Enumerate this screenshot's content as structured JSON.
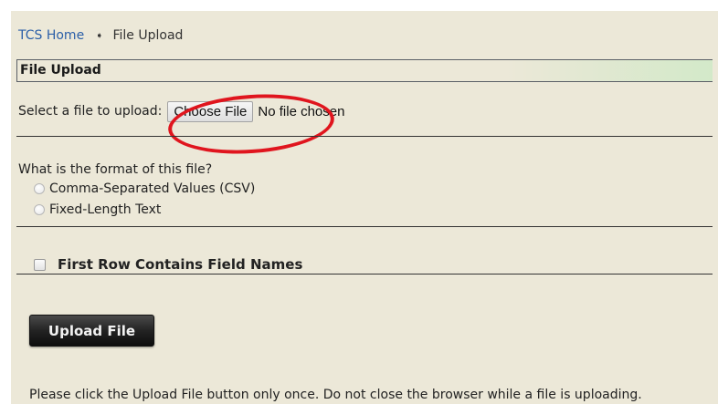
{
  "breadcrumb": {
    "home": "TCS Home",
    "separator": "➧",
    "current": "File Upload"
  },
  "section": {
    "title": "File Upload"
  },
  "file_input": {
    "label": "Select a file to upload:",
    "button": "Choose File",
    "status": "No file chosen"
  },
  "format": {
    "question": "What is the format of this file?",
    "options": [
      "Comma-Separated Values (CSV)",
      "Fixed-Length Text"
    ]
  },
  "first_row": {
    "label": "First Row Contains Field Names",
    "checked": false
  },
  "upload": {
    "button": "Upload File"
  },
  "notice": "Please click the Upload File button only once. Do not close the browser while a file is uploading.",
  "colors": {
    "panel": "#ece8d8",
    "link": "#2b5fa8",
    "annotation": "#e0151e",
    "header_gradient": "#d3e9c9"
  }
}
